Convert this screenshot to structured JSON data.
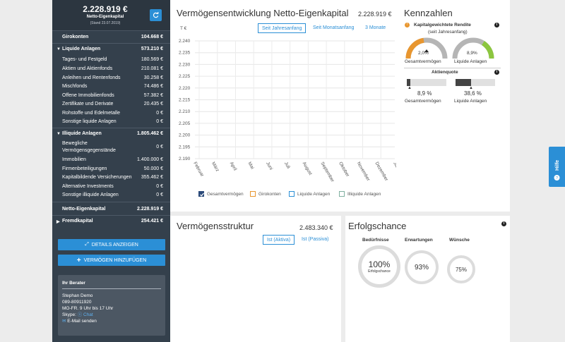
{
  "sidebar": {
    "total": "2.228.919 €",
    "total_label": "Netto-Eigenkapital",
    "date": "(Stand 23.07.2019)",
    "girokonten": {
      "label": "Girokonten",
      "value": "104.668 €"
    },
    "liquide": {
      "label": "Liquide Anlagen",
      "value": "573.210 €",
      "items": [
        {
          "label": "Tages- und Festgeld",
          "value": "180.569 €"
        },
        {
          "label": "Aktien und Aktienfonds",
          "value": "210.081 €"
        },
        {
          "label": "Anleihen und Rentenfonds",
          "value": "30.258 €"
        },
        {
          "label": "Mischfonds",
          "value": "74.486 €"
        },
        {
          "label": "Offene Immobilienfonds",
          "value": "57.382 €"
        },
        {
          "label": "Zertifikate und Derivate",
          "value": "20.435 €"
        },
        {
          "label": "Rohstoffe und Edelmetalle",
          "value": "0 €"
        },
        {
          "label": "Sonstige liquide Anlagen",
          "value": "0 €"
        }
      ]
    },
    "illiquide": {
      "label": "Illiquide Anlagen",
      "value": "1.805.462 €",
      "items": [
        {
          "label": "Bewegliche",
          "label2": "Vermögensgegenstände",
          "value": "0 €"
        },
        {
          "label": "Immobilien",
          "value": "1.400.000 €"
        },
        {
          "label": "Firmenbeteiligungen",
          "value": "50.000 €"
        },
        {
          "label": "Kapitalbildende Versicherungen",
          "value": "355.462 €"
        },
        {
          "label": "Alternative Investments",
          "value": "0 €"
        },
        {
          "label": "Sonstige illiquide Anlagen",
          "value": "0 €"
        }
      ]
    },
    "netto": {
      "label": "Netto-Eigenkapital",
      "value": "2.228.919 €"
    },
    "fremd": {
      "label": "Fremdkapital",
      "value": "254.421 €"
    },
    "btn_details": "DETAILS ANZEIGEN",
    "btn_add": "VERMÖGEN HINZUFÜGEN",
    "berater": {
      "title": "Ihr Berater",
      "name": "Stephan Demo",
      "phone": "089-80911920",
      "hours": "MO-FR. 9 Uhr bis 17 Uhr",
      "skype_label": "Skype:",
      "skype_link": "Chat",
      "email": "E-Mail senden"
    }
  },
  "main": {
    "title": "Vermögensentwicklung Netto-Eigenkapital",
    "title_value": "2.228.919 €",
    "tabs": [
      "Seit Jahresanfang",
      "Seit Monatsanfang",
      "3 Monate"
    ],
    "legend": [
      "Gesamtvermögen",
      "Girokonten",
      "Liquide Anlagen",
      "Illiquide Anlagen"
    ],
    "struktur_title": "Vermögensstruktur",
    "struktur_value": "2.483.340 €",
    "struktur_tabs": [
      "Ist (Aktiva)",
      "Ist (Passiva)"
    ],
    "erfolg_title": "Erfolgschance",
    "erfolg_cols": [
      "Bedürfnisse",
      "Erwartungen",
      "Wünsche"
    ],
    "erfolg_vals": [
      "100%",
      "93%",
      "75%"
    ],
    "erfolg_sub": "Erfolgschance"
  },
  "chart_data": {
    "type": "line",
    "ylabel": "T €",
    "yticks": [
      "2.240",
      "2.235",
      "2.230",
      "2.225",
      "2.220",
      "2.215",
      "2.210",
      "2.205",
      "2.200",
      "2.195",
      "2.190"
    ],
    "categories": [
      "Februar",
      "März",
      "April",
      "Mai",
      "Juni",
      "Juli",
      "August",
      "September",
      "Oktober",
      "November",
      "Dezember",
      "Januar"
    ],
    "ylim": [
      2190,
      2240
    ],
    "grid": true,
    "series": []
  },
  "kennzahlen": {
    "title": "Kennzahlen",
    "rendite_title": "Kapitalgewichtete Rendite",
    "rendite_sub": "(seit Jahresanfang)",
    "gauge1_val": "2,0%",
    "gauge1_label": "Gesamtvermögen",
    "gauge2_val": "8,9%",
    "gauge2_label": "Liquide Anlagen",
    "quote_title": "Aktienquote",
    "bar1_val": "8,9 %",
    "bar1_label": "Gesamtvermögen",
    "bar2_val": "38,6 %",
    "bar2_label": "Liquide Anlagen"
  },
  "hilfe": "Hilfe",
  "colors": {
    "accent": "#2b8fd6",
    "sidebar": "#34404c",
    "gauge_orange": "#e8962f",
    "gauge_green": "#8cc63f"
  }
}
